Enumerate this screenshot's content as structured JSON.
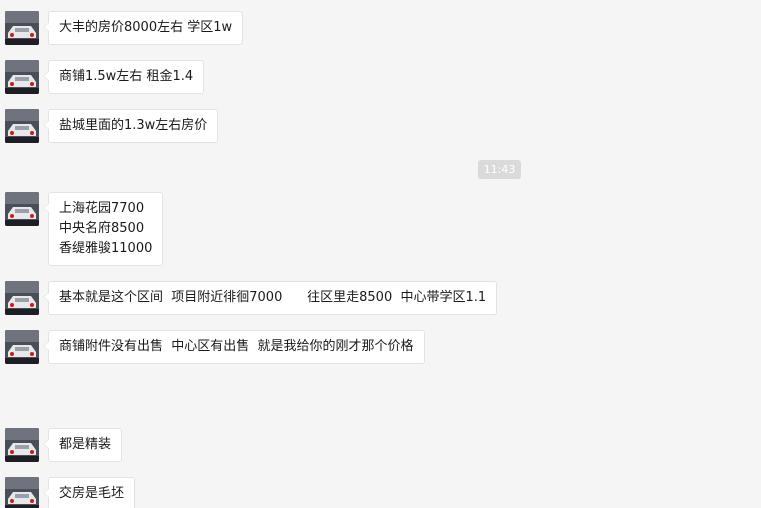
{
  "timestamp": "11:43",
  "messages": [
    {
      "text": "大丰的房价8000左右 学区1w"
    },
    {
      "text": "商铺1.5w左右 租金1.4"
    },
    {
      "text": "盐城里面的1.3w左右房价"
    },
    {
      "text": "上海花园7700\n中央名府8500\n香缇雅骏11000"
    },
    {
      "text": "基本就是这个区间  项目附近徘徊7000      往区里走8500  中心带学区1.1"
    },
    {
      "text": "商铺附件没有出售  中心区有出售  就是我给你的刚才那个价格"
    },
    {
      "text": "都是精装"
    },
    {
      "text": "交房是毛坯"
    }
  ]
}
